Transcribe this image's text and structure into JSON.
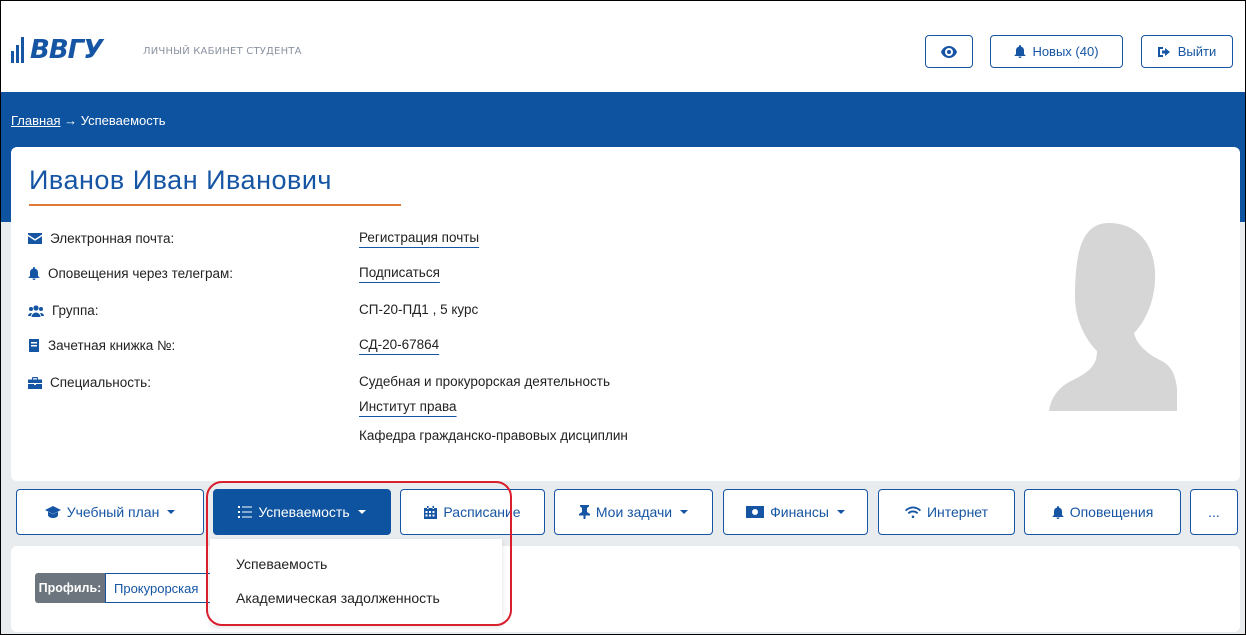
{
  "header": {
    "logo_text": "ВВГУ",
    "subtitle": "ЛИЧНЫЙ КАБИНЕТ СТУДЕНТА",
    "news_label": "Новых (40)",
    "logout_label": "Выйти"
  },
  "breadcrumb": {
    "home": "Главная",
    "separator": " → ",
    "current": "Успеваемость"
  },
  "profile": {
    "name": "Иванов Иван Иванович",
    "rows": [
      {
        "label": "Электронная почта:",
        "value": "Регистрация почты"
      },
      {
        "label": "Оповещения через телеграм:",
        "value": "Подписаться"
      },
      {
        "label": "Группа:",
        "value": "СП-20-ПД1 , 5 курс"
      },
      {
        "label": "Зачетная книжка №:",
        "value": "СД-20-67864"
      },
      {
        "label": "Специальность:",
        "value": "Судебная и прокурорская деятельность"
      }
    ],
    "institute": "Институт права",
    "department": "Кафедра гражданско-правовых дисциплин"
  },
  "nav": {
    "items": [
      {
        "label": "Учебный план"
      },
      {
        "label": "Успеваемость"
      },
      {
        "label": "Расписание"
      },
      {
        "label": "Мои задачи"
      },
      {
        "label": "Финансы"
      },
      {
        "label": "Интернет"
      },
      {
        "label": "Оповещения"
      },
      {
        "label": "..."
      }
    ]
  },
  "dropdown": {
    "items": [
      "Успеваемость",
      "Академическая задолженность"
    ]
  },
  "profiles": {
    "label": "Профиль:",
    "tab": "Прокурорская"
  },
  "colors": {
    "brand_blue": "#0e53a0",
    "accent_orange": "#e07a3a",
    "highlight_red": "#d91e2c"
  }
}
